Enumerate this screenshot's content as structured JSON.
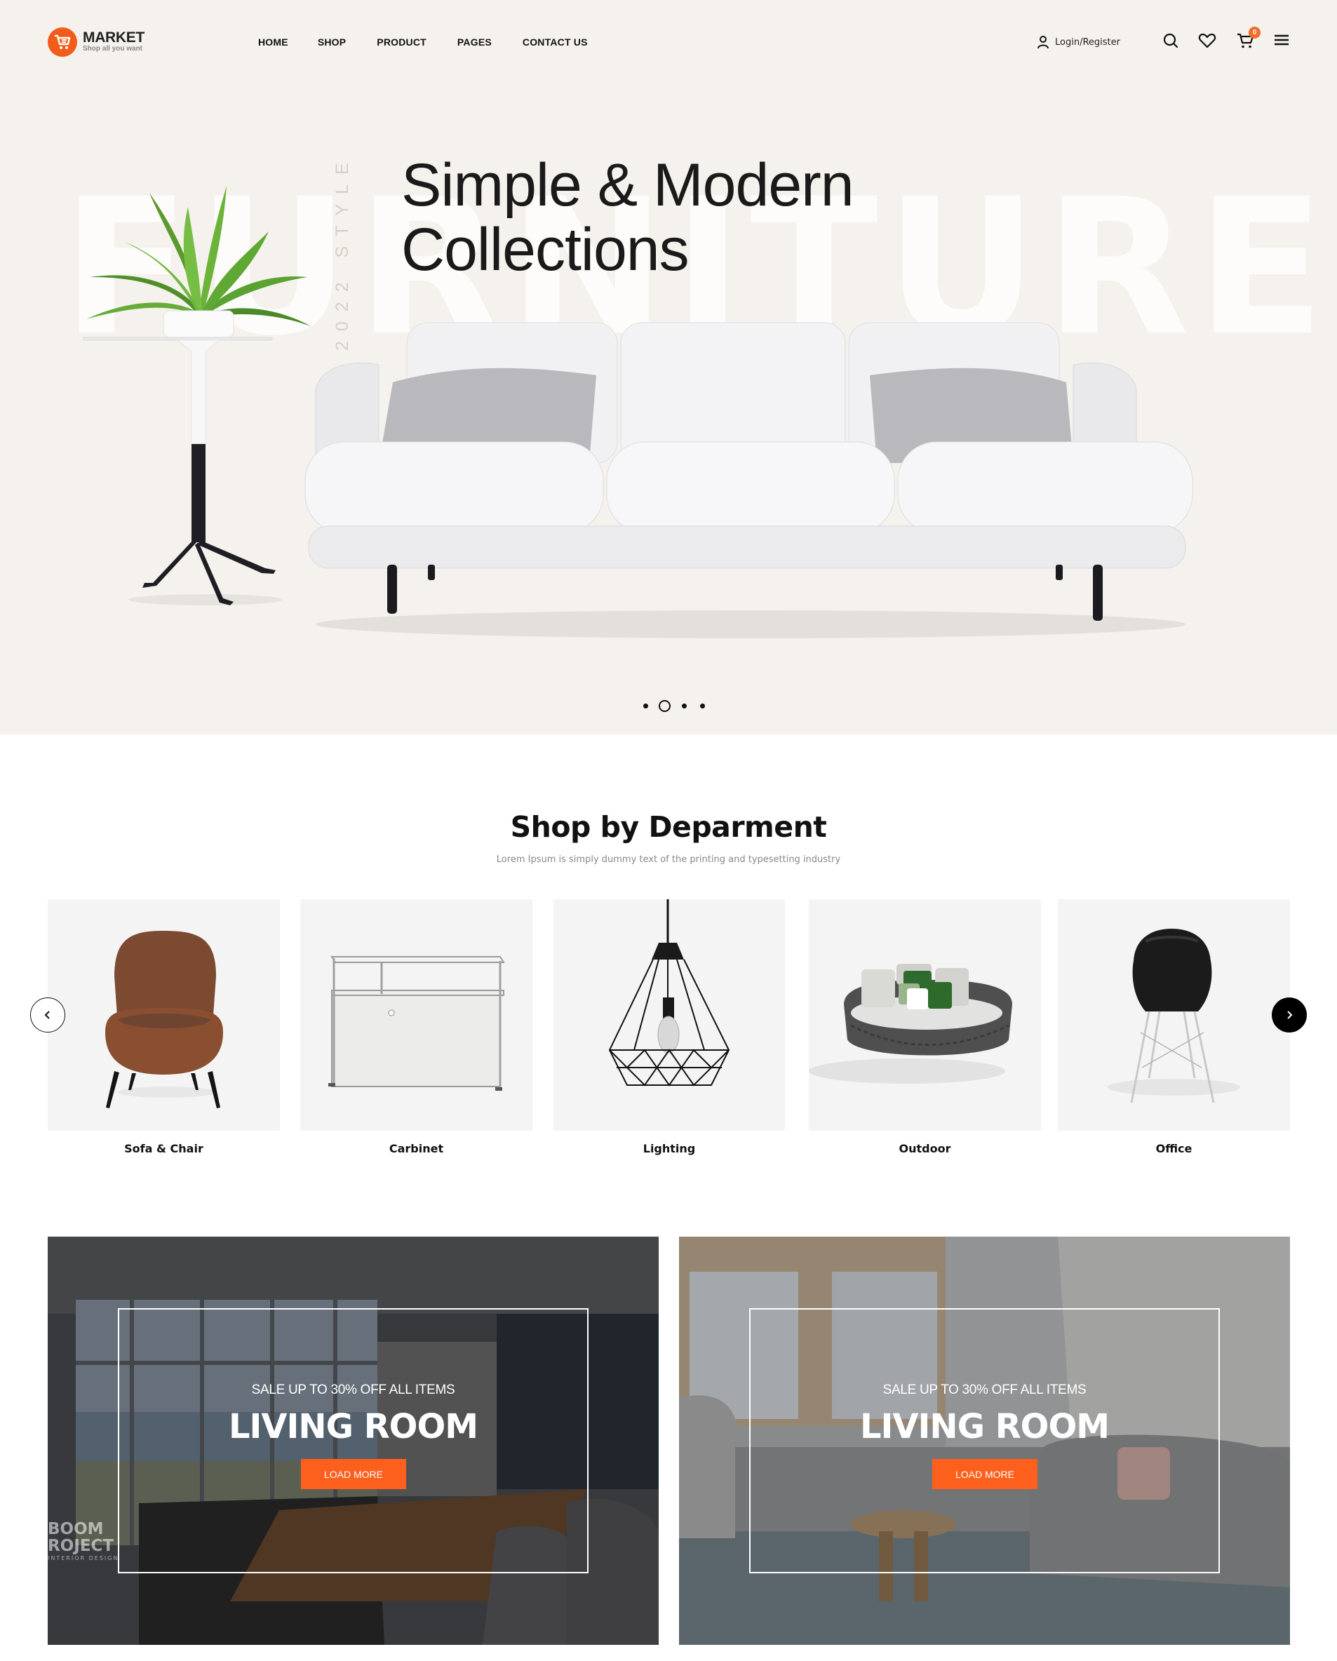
{
  "brand": {
    "name": "MARKET",
    "tagline": "Shop all you want",
    "accent_color": "#f25c1a"
  },
  "nav": {
    "items": [
      {
        "label": "HOME"
      },
      {
        "label": "SHOP"
      },
      {
        "label": "PRODUCT"
      },
      {
        "label": "PAGES"
      },
      {
        "label": "CONTACT US"
      }
    ]
  },
  "header_actions": {
    "login_label": "Login/Register",
    "user_icon": "user-icon",
    "search_icon": "search-icon",
    "wishlist_icon": "heart-icon",
    "cart_icon": "cart-icon",
    "cart_count": "0",
    "menu_icon": "hamburger-menu-icon"
  },
  "hero": {
    "title_line1": "Simple & Modern",
    "title_line2": "Collections",
    "background_word": "FURNITURE",
    "vertical_label": "2022 STYLE",
    "background_color": "#f5f1ec",
    "slider": {
      "total": 4,
      "active_index": 1
    }
  },
  "department": {
    "title": "Shop by Deparment",
    "subtitle": "Lorem Ipsum is simply dummy text of the printing and typesetting industry",
    "prev_icon": "chevron-left-icon",
    "next_icon": "chevron-right-icon",
    "categories": [
      {
        "label": "Sofa & Chair"
      },
      {
        "label": "Carbinet"
      },
      {
        "label": "Lighting"
      },
      {
        "label": "Outdoor"
      },
      {
        "label": "Office"
      }
    ]
  },
  "banners": [
    {
      "sale_text": "SALE UP TO 30% OFF ALL ITEMS",
      "title": "LIVING ROOM",
      "button_label": "LOAD MORE",
      "watermark_line1": "BOOM",
      "watermark_line2": "ROJECT",
      "watermark_line3": "INTERIOR DESIGN"
    },
    {
      "sale_text": "SALE UP TO 30% OFF ALL ITEMS",
      "title": "LIVING ROOM",
      "button_label": "LOAD MORE"
    }
  ],
  "button_color": "#fd5f1d"
}
